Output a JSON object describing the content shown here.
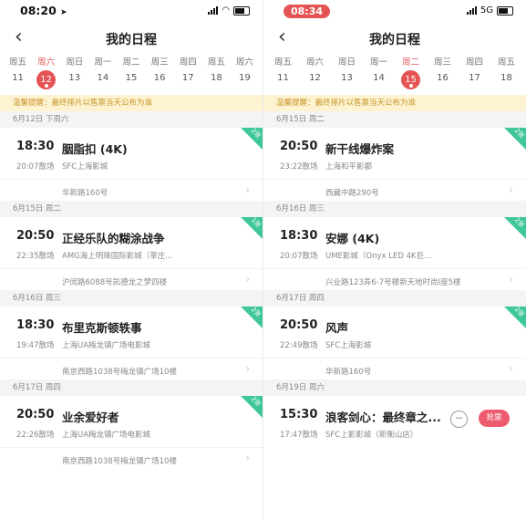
{
  "left": {
    "status_time": "08:20",
    "status_arrow": "➤",
    "nav_title": "我的日程",
    "back_icon": "‹",
    "days": [
      {
        "week": "周五",
        "num": "11",
        "selected": false
      },
      {
        "week": "周六",
        "num": "12",
        "selected": true
      },
      {
        "week": "周日",
        "num": "13",
        "selected": false
      },
      {
        "week": "周一",
        "num": "14",
        "selected": false
      },
      {
        "week": "周二",
        "num": "15",
        "selected": false
      },
      {
        "week": "周三",
        "num": "16",
        "selected": false
      },
      {
        "week": "周四",
        "num": "17",
        "selected": false
      },
      {
        "week": "周五",
        "num": "18",
        "selected": false
      },
      {
        "week": "周六",
        "num": "19",
        "selected": false
      }
    ],
    "tip": "温馨提醒：最终排片以售票当天公布为准",
    "groups": [
      {
        "date": "6月12日 下周六",
        "cards": [
          {
            "tag": "2张",
            "time": "18:30",
            "movie": "胭脂扣 (4K)",
            "end": "20:07散场",
            "cinema": "SFC上海影城",
            "address": "华新路160号"
          }
        ]
      },
      {
        "date": "6月15日 周二",
        "cards": [
          {
            "tag": "1张",
            "time": "20:50",
            "movie": "正经乐队的糊涂战争",
            "end": "22:35散场",
            "cinema": "AMG海上明珠国际影城（莘庄...",
            "address": "沪闵路6088号凯德龙之梦四楼"
          }
        ]
      },
      {
        "date": "6月16日 周三",
        "cards": [
          {
            "tag": "2张",
            "time": "18:30",
            "movie": "布里克斯顿轶事",
            "end": "19:47散场",
            "cinema": "上海UA梅龙镇广场电影城",
            "address": "南京西路1038号梅龙镇广场10楼"
          }
        ]
      },
      {
        "date": "6月17日 周四",
        "cards": [
          {
            "tag": "2张",
            "time": "20:50",
            "movie": "业余爱好者",
            "end": "22:26散场",
            "cinema": "上海UA梅龙镇广场电影城",
            "address": "南京西路1038号梅龙镇广场10楼"
          }
        ]
      }
    ]
  },
  "right": {
    "status_time": "08:34",
    "status_network": "5G",
    "nav_title": "我的日程",
    "back_icon": "‹",
    "days": [
      {
        "week": "周五",
        "num": "11",
        "selected": false
      },
      {
        "week": "周六",
        "num": "12",
        "selected": false
      },
      {
        "week": "周日",
        "num": "13",
        "selected": false
      },
      {
        "week": "周一",
        "num": "14",
        "selected": false
      },
      {
        "week": "周二",
        "num": "15",
        "selected": true
      },
      {
        "week": "周三",
        "num": "16",
        "selected": false
      },
      {
        "week": "周四",
        "num": "17",
        "selected": false
      },
      {
        "week": "周五",
        "num": "18",
        "selected": false
      }
    ],
    "tip": "温馨提醒：最终排片以售票当天公布为准",
    "groups": [
      {
        "date": "6月15日 周二",
        "cards": [
          {
            "tag": "2张",
            "time": "20:50",
            "movie": "新干线爆炸案",
            "end": "23:22散场",
            "cinema": "上海和平影都",
            "address": "西藏中路290号"
          }
        ]
      },
      {
        "date": "6月16日 周三",
        "cards": [
          {
            "tag": "2张",
            "time": "18:30",
            "movie": "安娜 (4K)",
            "end": "20:07散场",
            "cinema": "UME影城（Onyx LED 4K巨...",
            "address": "兴业路123弄6-7号楼新天地时尚I座5楼"
          }
        ]
      },
      {
        "date": "6月17日 周四",
        "cards": [
          {
            "tag": "2张",
            "time": "20:50",
            "movie": "风声",
            "end": "22:49散场",
            "cinema": "SFC上海影城",
            "address": "华新路160号"
          }
        ]
      },
      {
        "date": "6月19日 周六",
        "cards": [
          {
            "tag": "",
            "time": "15:30",
            "movie": "浪客剑心：最终章之...",
            "end": "17:47散场",
            "cinema": "SFC上影影城（新衡山店）",
            "address": "",
            "minus": "−",
            "grab": "抢票"
          }
        ]
      }
    ]
  },
  "colors": {
    "accent": "#e55454",
    "tag_green": "#3fc79b",
    "tip_bg": "#fdf3d0",
    "grab_pink": "#ee5b6e"
  },
  "icons": {
    "back": "chevron-left-icon",
    "chevron": "chevron-right-icon",
    "minus": "minus-circle-icon"
  }
}
